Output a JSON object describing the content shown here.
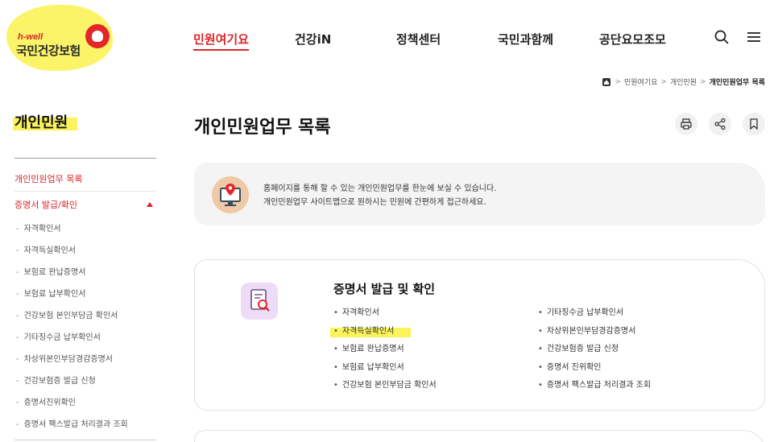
{
  "logo": {
    "sub": "h-well",
    "main": "국민건강보험"
  },
  "gnb": {
    "items": [
      "민원여기요",
      "건강iN",
      "정책센터",
      "국민과함께",
      "공단요모조모"
    ],
    "active_index": 0
  },
  "icons": {
    "search": "search-icon",
    "menu": "hamburger-menu-icon"
  },
  "breadcrumb": {
    "home_icon": "home-icon",
    "items": [
      "민원여기요",
      "개인민원",
      "개인민원업무 목록"
    ]
  },
  "sidebar": {
    "title": "개인민원",
    "link": "개인민원업무 목록",
    "group": "증명서 발급/확인",
    "subitems": [
      "자격확인서",
      "자격득실확인서",
      "보험료 완납증명서",
      "보험료 납부확인서",
      "건강보험 본인부담금 확인서",
      "기타징수금 납부확인서",
      "차상위본인부담경감증명서",
      "건강보험증 발급 신청",
      "증명서진위확인",
      "증명서 팩스발급 처리결과 조회"
    ]
  },
  "main": {
    "title": "개인민원업무 목록",
    "tools": [
      "print-icon",
      "share-icon",
      "bookmark-icon"
    ],
    "notice": {
      "line1": "홈페이지를 통해 할 수 있는 개인민원업무를 한눈에 보실 수 있습니다.",
      "line2": "개인민원업무 사이트맵으로 원하시는 민원에 간편하게 접근하세요."
    },
    "card": {
      "title": "증명서 발급 및 확인",
      "left": [
        "자격확인서",
        "자격득실확인서",
        "보험료 완납증명서",
        "보험료 납부확인서",
        "건강보험 본인부담금 확인서"
      ],
      "right": [
        "기타징수금 납부확인서",
        "차상위본인부담경감증명서",
        "건강보험증 발급 신청",
        "증명서 진위확인",
        "증명서 팩스발급 처리결과 조회"
      ]
    }
  },
  "colors": {
    "brand": "#d9252a",
    "highlight": "#fbf35b"
  }
}
